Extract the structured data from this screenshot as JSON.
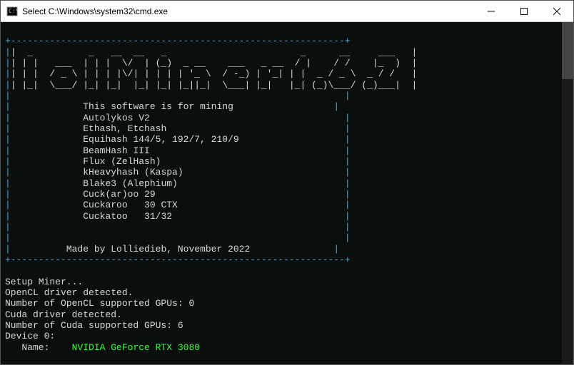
{
  "titlebar": {
    "title": "Select C:\\Windows\\system32\\cmd.exe"
  },
  "border_top": "+------------------------------------------------------------+",
  "border_side": "|",
  "border_bottom": "+------------------------------------------------------------+",
  "ascii_art": [
    "|  _          _   __  __   _                        _      __     ___   |",
    "| | |   ___  | | |  \\/  | (_)  _ __    ___   _ __  / |    / /    |_  )  |",
    "| | |  / _ \\ | | | |\\/| | | | | '_ \\  / -_) | '_| | |  _ / _ \\  _ / /   |",
    "| |_|  \\___/ |_| |_|  |_| |_| |_||_|  \\___| |_|   |_| (_)\\___/ (_)___|  |"
  ],
  "software_line": "This software is for mining",
  "algorithms": [
    "Autolykos V2",
    "Ethash, Etchash",
    "Equihash 144/5, 192/7, 210/9",
    "BeamHash III",
    "Flux (ZelHash)",
    "kHeavyhash (Kaspa)",
    "Blake3 (Alephium)",
    "Cuck(ar)oo 29",
    "Cuckaroo   30 CTX",
    "Cuckatoo   31/32"
  ],
  "made_by": "Made by Lolliedieb, November 2022",
  "status_lines": [
    "Setup Miner...",
    "OpenCL driver detected.",
    "Number of OpenCL supported GPUs: 0",
    "Cuda driver detected.",
    "Number of Cuda supported GPUs: 6",
    "Device 0:"
  ],
  "device_name_label": "   Name:    ",
  "device_name": "NVIDIA GeForce RTX 3080"
}
